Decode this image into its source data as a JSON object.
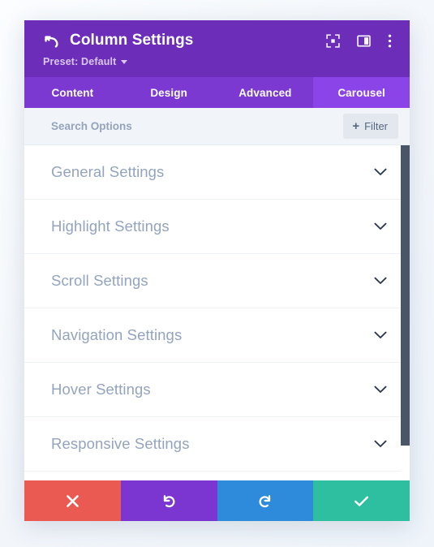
{
  "header": {
    "title": "Column Settings",
    "back_icon": "back-arrow-icon",
    "preset_label": "Preset: Default",
    "actions": [
      {
        "name": "focus-element-icon",
        "label": "Focus Element"
      },
      {
        "name": "layout-panel-icon",
        "label": "Change Layout"
      },
      {
        "name": "more-options-icon",
        "label": "More Options"
      }
    ],
    "colors": {
      "background": "#6C2EB9",
      "title_text": "#FFFFFF",
      "preset_text": "#D9C7F0"
    }
  },
  "tabs": {
    "items": [
      {
        "label": "Content",
        "active": false
      },
      {
        "label": "Design",
        "active": false
      },
      {
        "label": "Advanced",
        "active": false
      },
      {
        "label": "Carousel",
        "active": true
      }
    ],
    "colors": {
      "bar": "#7B39D1",
      "active": "#8B44E8",
      "text": "#FFFFFF"
    }
  },
  "search": {
    "placeholder": "Search Options",
    "value": "",
    "filter_label": "Filter",
    "filter_plus": "+"
  },
  "settings": {
    "rows": [
      {
        "label": "General Settings",
        "expanded": false
      },
      {
        "label": "Highlight Settings",
        "expanded": false
      },
      {
        "label": "Scroll Settings",
        "expanded": false
      },
      {
        "label": "Navigation Settings",
        "expanded": false
      },
      {
        "label": "Hover Settings",
        "expanded": false
      },
      {
        "label": "Responsive Settings",
        "expanded": false
      }
    ],
    "chevron_icon": "chevron-down-icon",
    "label_color": "#93A4BC"
  },
  "scrollbar": {
    "thumb_color": "#4A5668",
    "position_percent": 0
  },
  "footer": {
    "buttons": [
      {
        "name": "cancel-button",
        "icon": "close-icon",
        "color": "#EA5A52"
      },
      {
        "name": "undo-button",
        "icon": "undo-icon",
        "color": "#7B35D1"
      },
      {
        "name": "redo-button",
        "icon": "redo-icon",
        "color": "#2E8ADA"
      },
      {
        "name": "save-button",
        "icon": "checkmark-icon",
        "color": "#2DBFA0"
      }
    ]
  }
}
